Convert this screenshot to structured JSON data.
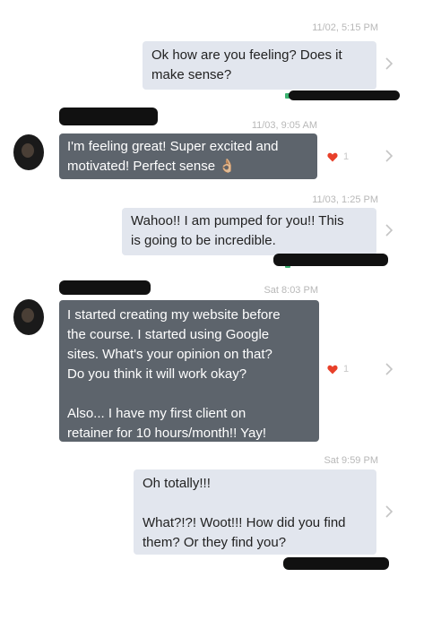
{
  "messages": [
    {
      "timestamp": "11/02, 5:15 PM",
      "direction": "out",
      "text": "Ok how are you feeling? Does it\nmake sense?"
    },
    {
      "timestamp": "11/03, 9:05 AM",
      "direction": "in",
      "text": "I'm feeling great! Super excited and\nmotivated! Perfect sense 👌🏼",
      "reaction_count": "1"
    },
    {
      "timestamp": "11/03, 1:25 PM",
      "direction": "out",
      "text": "Wahoo!! I am pumped for you!! This\nis going to be incredible."
    },
    {
      "timestamp": "Sat 8:03 PM",
      "direction": "in",
      "text": "I started creating my website before\nthe course. I started using Google\nsites. What's your opinion on that?\nDo you think it will work okay?\n\nAlso... I have my first client on\nretainer for 10 hours/month!! Yay!",
      "reaction_count": "1"
    },
    {
      "timestamp": "Sat 9:59 PM",
      "direction": "out",
      "text": "Oh totally!!!\n\nWhat?!?! Woot!!! How did you find\nthem? Or they find you?"
    }
  ],
  "colors": {
    "outgoing_bubble": "#e2e6ee",
    "incoming_bubble": "#5d646c",
    "heart": "#e8402a",
    "read_indicator": "#3cb371"
  },
  "icons": {
    "chevron": "chevron-right-icon",
    "reaction": "heart-icon",
    "avatar": "avatar"
  }
}
